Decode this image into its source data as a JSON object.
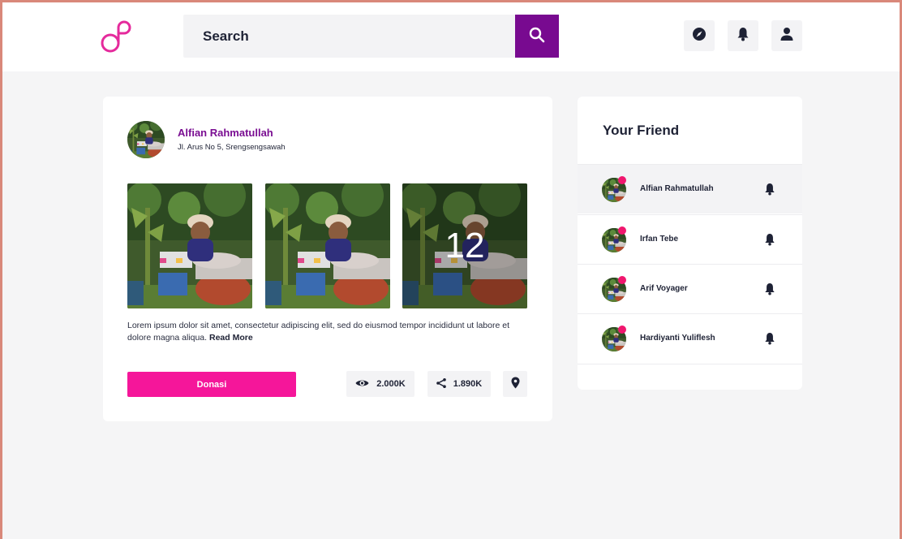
{
  "header": {
    "search": {
      "placeholder": "Search",
      "value": ""
    },
    "icons": [
      "logo-icon",
      "search-icon",
      "compass-icon",
      "bell-icon",
      "user-icon"
    ]
  },
  "post": {
    "author_name": "Alfian Rahmatullah",
    "author_address": "Jl. Arus No 5, Srengsengsawah",
    "photo_more_count": "12",
    "text": "Lorem ipsum dolor sit amet, consectetur adipiscing elit, sed do eiusmod tempor incididunt ut labore et dolore magna aliqua.",
    "read_more": "Read More",
    "donate_label": "Donasi",
    "views": "2.000K",
    "shares": "1.890K"
  },
  "friends": {
    "title": "Your Friend",
    "items": [
      {
        "name": "Alfian Rahmatullah"
      },
      {
        "name": "Irfan Tebe"
      },
      {
        "name": "Arif Voyager"
      },
      {
        "name": "Hardiyanti Yuliflesh"
      }
    ]
  },
  "colors": {
    "brand_purple": "#780a90",
    "donate_pink": "#f5169a",
    "notification_dot": "#f0176e",
    "text_dark": "#1e2235"
  }
}
